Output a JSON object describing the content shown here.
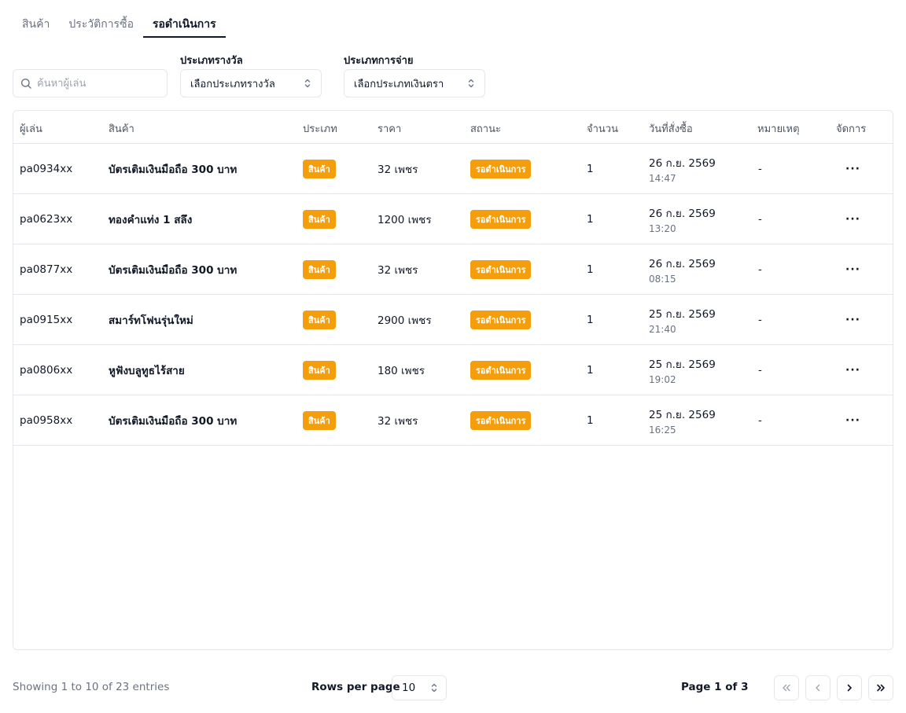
{
  "tabs": [
    {
      "label": "สินค้า",
      "active": false
    },
    {
      "label": "ประวัติการซื้อ",
      "active": false
    },
    {
      "label": "รอดำเนินการ",
      "active": true
    }
  ],
  "filters": {
    "search_placeholder": "ค้นหาผู้เล่น",
    "reward_type_label": "ประเภทรางวัล",
    "reward_type_value": "เลือกประเภทรางวัล",
    "payment_type_label": "ประเภทการจ่าย",
    "payment_type_value": "เลือกประเภทเงินตรา"
  },
  "table": {
    "headers": {
      "player": "ผู้เล่น",
      "product": "สินค้า",
      "type": "ประเภท",
      "price": "ราคา",
      "status": "สถานะ",
      "quantity": "จำนวน",
      "date": "วันที่สั่งซื้อ",
      "note": "หมายเหตุ",
      "actions": "จัดการ"
    },
    "rows": [
      {
        "player": "pa0934xx",
        "product": "บัตรเติมเงินมือถือ 300 บาท",
        "type": "สินค้า",
        "price": "32 เพชร",
        "status": "รอดำเนินการ",
        "quantity": "1",
        "date": "26 ก.ย. 2569",
        "time": "14:47",
        "note": "-",
        "actions": "···"
      },
      {
        "player": "pa0623xx",
        "product": "ทองคำแท่ง 1 สลึง",
        "type": "สินค้า",
        "price": "1200 เพชร",
        "status": "รอดำเนินการ",
        "quantity": "1",
        "date": "26 ก.ย. 2569",
        "time": "13:20",
        "note": "-",
        "actions": "···"
      },
      {
        "player": "pa0877xx",
        "product": "บัตรเติมเงินมือถือ 300 บาท",
        "type": "สินค้า",
        "price": "32 เพชร",
        "status": "รอดำเนินการ",
        "quantity": "1",
        "date": "26 ก.ย. 2569",
        "time": "08:15",
        "note": "-",
        "actions": "···"
      },
      {
        "player": "pa0915xx",
        "product": "สมาร์ทโฟนรุ่นใหม่",
        "type": "สินค้า",
        "price": "2900 เพชร",
        "status": "รอดำเนินการ",
        "quantity": "1",
        "date": "25 ก.ย. 2569",
        "time": "21:40",
        "note": "-",
        "actions": "···"
      },
      {
        "player": "pa0806xx",
        "product": "หูฟังบลูทูธไร้สาย",
        "type": "สินค้า",
        "price": "180 เพชร",
        "status": "รอดำเนินการ",
        "quantity": "1",
        "date": "25 ก.ย. 2569",
        "time": "19:02",
        "note": "-",
        "actions": "···"
      },
      {
        "player": "pa0958xx",
        "product": "บัตรเติมเงินมือถือ 300 บาท",
        "type": "สินค้า",
        "price": "32 เพชร",
        "status": "รอดำเนินการ",
        "quantity": "1",
        "date": "25 ก.ย. 2569",
        "time": "16:25",
        "note": "-",
        "actions": "···"
      }
    ]
  },
  "footer": {
    "showing": "Showing 1 to 10 of 23 entries",
    "rows_per_page_label": "Rows per page",
    "rows_per_page_value": "10",
    "page_label": "Page 1 of 3"
  },
  "colors": {
    "badge": "#f59e0b",
    "border": "#e5e7eb",
    "muted_text": "#6b7280"
  }
}
